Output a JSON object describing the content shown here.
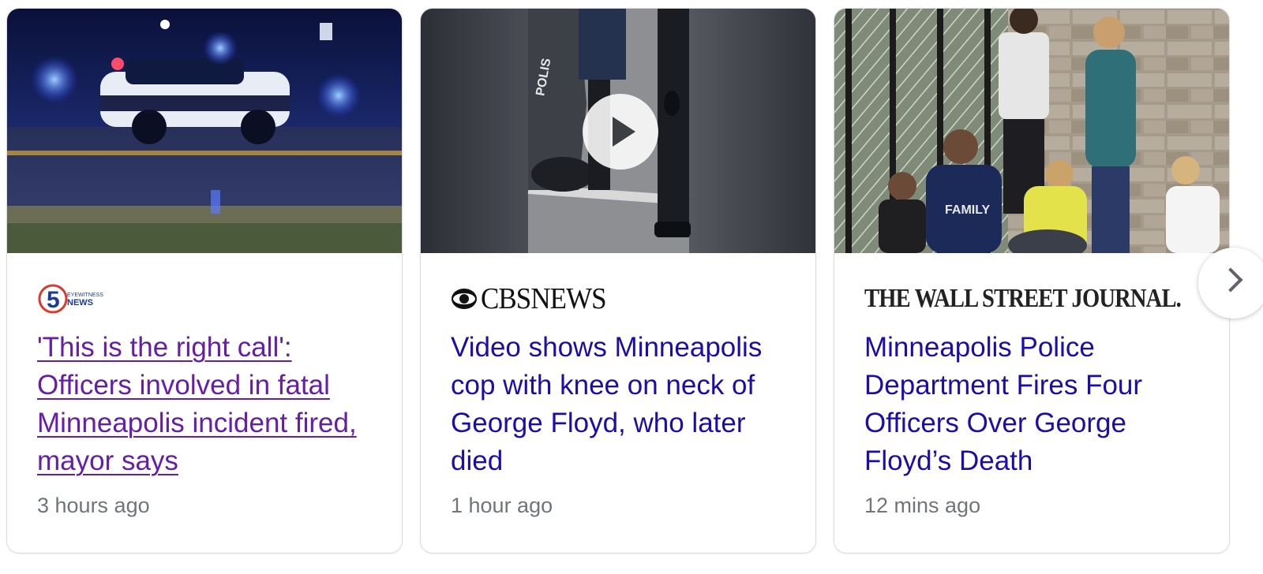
{
  "cards": [
    {
      "source": {
        "name": "KSTP 5 Eyewitness News",
        "logo_text": "5",
        "logo_small_text": "EYEWITNESS NEWS"
      },
      "headline": "'This is the right call': Officers involved in fatal Minneapolis incident fired, mayor says",
      "time": "3 hours ago",
      "visited": true,
      "thumbnail": "police-car-night-scene"
    },
    {
      "source": {
        "name": "CBS News",
        "logo_text": "CBSNEWS"
      },
      "headline": "Video shows Minneapolis cop with knee on neck of George Floyd, who later died",
      "time": "1 hour ago",
      "visited": false,
      "thumbnail": "officer-by-police-car-video",
      "has_video": true
    },
    {
      "source": {
        "name": "The Wall Street Journal",
        "logo_text": "THE WALL STREET JOURNAL."
      },
      "headline": "Minneapolis Police Department Fires Four Officers Over George Floyd’s Death",
      "time": "12 mins ago",
      "visited": false,
      "thumbnail": "people-by-fence-photo"
    }
  ],
  "colors": {
    "link": "#1a0dab",
    "visited_link": "#681da8",
    "meta": "#70757a",
    "border": "#dadce0"
  },
  "icons": {
    "play": "play-icon",
    "next": "chevron-right-icon"
  }
}
